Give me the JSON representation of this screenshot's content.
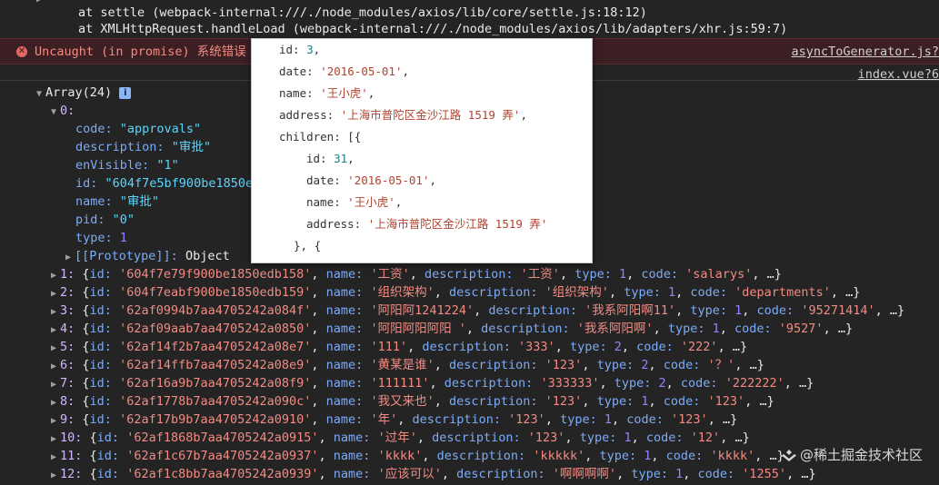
{
  "stack": [
    "at settle (webpack-internal:///./node_modules/axios/lib/core/settle.js:18:12)",
    "at XMLHttpRequest.handleLoad (webpack-internal:///./node_modules/axios/lib/adapters/xhr.js:59:7)"
  ],
  "error": {
    "icon": "error-circle-icon",
    "message": "Uncaught (in promise) 系统错误",
    "link": "asyncToGenerator.js?"
  },
  "source_link": "index.vue?6",
  "array_header": {
    "label": "Array(24)",
    "info": "i"
  },
  "item0": {
    "index": "0:",
    "fields": [
      {
        "key": "code:",
        "value": "\"approvals\"",
        "type": "string"
      },
      {
        "key": "description:",
        "value": "\"审批\"",
        "type": "string"
      },
      {
        "key": "enVisible:",
        "value": "\"1\"",
        "type": "string"
      },
      {
        "key": "id:",
        "value": "\"604f7e5bf900be1850e",
        "type": "string"
      },
      {
        "key": "name:",
        "value": "\"审批\"",
        "type": "string"
      },
      {
        "key": "pid:",
        "value": "\"0\"",
        "type": "string"
      },
      {
        "key": "type:",
        "value": "1",
        "type": "number"
      }
    ],
    "prototype_key": "[[Prototype]]:",
    "prototype_value": "Object"
  },
  "rows": [
    {
      "idx": "1:",
      "id": "'604f7e79f900be1850edb158'",
      "name": "'工资'",
      "f3k": "description:",
      "f3": "'工资'",
      "f4k": "type:",
      "f4": "1",
      "f5k": "code:",
      "f5": "'salarys'",
      "tail": ", …}"
    },
    {
      "idx": "2:",
      "id": "'604f7eabf900be1850edb159'",
      "name": "'组织架构'",
      "f3k": "description:",
      "f3": "'组织架构'",
      "f4k": "type:",
      "f4": "1",
      "f5k": "code:",
      "f5": "'departments'",
      "tail": ", …}"
    },
    {
      "idx": "3:",
      "id": "'62af0994b7aa4705242a084f'",
      "name": "'阿阳阿1241224'",
      "f3k": "description:",
      "f3": "'我系阿阳啊11'",
      "f4k": "type:",
      "f4": "1",
      "f5k": "code:",
      "f5": "'95271414'",
      "tail": ", …}"
    },
    {
      "idx": "4:",
      "id": "'62af09aab7aa4705242a0850'",
      "name": "'阿阳阿阳阿阳 '",
      "f3k": "description:",
      "f3": "'我系阿阳啊'",
      "f4k": "type:",
      "f4": "1",
      "f5k": "code:",
      "f5": "'9527'",
      "tail": ", …}"
    },
    {
      "idx": "5:",
      "id": "'62af14f2b7aa4705242a08e7'",
      "name": "'111'",
      "f3k": "description:",
      "f3": "'333'",
      "f4k": "type:",
      "f4": "2",
      "f5k": "code:",
      "f5": "'222'",
      "tail": ", …}"
    },
    {
      "idx": "6:",
      "id": "'62af14ffb7aa4705242a08e9'",
      "name": "'黄某是谁'",
      "f3k": "description:",
      "f3": "'123'",
      "f4k": "type:",
      "f4": "2",
      "f5k": "code:",
      "f5": "'？'",
      "tail": ", …}"
    },
    {
      "idx": "7:",
      "id": "'62af16a9b7aa4705242a08f9'",
      "name": "'111111'",
      "f3k": "description:",
      "f3": "'333333'",
      "f4k": "type:",
      "f4": "2",
      "f5k": "code:",
      "f5": "'222222'",
      "tail": ", …}"
    },
    {
      "idx": "8:",
      "id": "'62af1778b7aa4705242a090c'",
      "name": "'我又来也'",
      "f3k": "description:",
      "f3": "'123'",
      "f4k": "type:",
      "f4": "1",
      "f5k": "code:",
      "f5": "'123'",
      "tail": ", …}"
    },
    {
      "idx": "9:",
      "id": "'62af17b9b7aa4705242a0910'",
      "name": "'年'",
      "f3k": "description:",
      "f3": "'123'",
      "f4k": "type:",
      "f4": "1",
      "f5k": "code:",
      "f5": "'123'",
      "tail": ", …}"
    },
    {
      "idx": "10:",
      "id": "'62af1868b7aa4705242a0915'",
      "name": "'过年'",
      "f3k": "description:",
      "f3": "'123'",
      "f4k": "type:",
      "f4": "1",
      "f5k": "code:",
      "f5": "'12'",
      "tail": ", …}"
    },
    {
      "idx": "11:",
      "id": "'62af1c67b7aa4705242a0937'",
      "name": "'kkkk'",
      "f3k": "description:",
      "f3": "'kkkkk'",
      "f4k": "type:",
      "f4": "1",
      "f5k": "code:",
      "f5": "'kkkk'",
      "tail": ", …}"
    },
    {
      "idx": "12:",
      "id": "'62af1c8bb7aa4705242a0939'",
      "name": "'应该可以'",
      "f3k": "description:",
      "f3": "'啊啊啊啊'",
      "f4k": "type:",
      "f4": "1",
      "f5k": "code:",
      "f5": "'1255'",
      "tail": ", …}"
    }
  ],
  "popup": {
    "lines": [
      {
        "k": "id:",
        "v": "3",
        "vt": "n",
        "tail": ","
      },
      {
        "k": "date:",
        "v": "'2016-05-01'",
        "vt": "s",
        "tail": ","
      },
      {
        "k": "name:",
        "v": "'王小虎'",
        "vt": "s",
        "tail": ","
      },
      {
        "k": "address:",
        "v": "'上海市普陀区金沙江路 1519 弄'",
        "vt": "s",
        "tail": ","
      },
      {
        "k": "children: [{",
        "v": "",
        "vt": "",
        "tail": ""
      },
      {
        "k": "id:",
        "v": "31",
        "vt": "n",
        "tail": ","
      },
      {
        "k": "date:",
        "v": "'2016-05-01'",
        "vt": "s",
        "tail": ","
      },
      {
        "k": "name:",
        "v": "'王小虎'",
        "vt": "s",
        "tail": ","
      },
      {
        "k": "address:",
        "v": "'上海市普陀区金沙江路 1519 弄'",
        "vt": "s",
        "tail": ""
      },
      {
        "k": "}, {",
        "v": "",
        "vt": "",
        "tail": ""
      }
    ]
  },
  "watermark": {
    "text": "@稀土掘金技术社区"
  },
  "colors": {
    "error_bg": "#3c1f22",
    "error_text": "#f28b82",
    "console_bg": "#242424",
    "key": "#7cacf8",
    "string": "#5cd5fb",
    "number": "#9980ff"
  }
}
